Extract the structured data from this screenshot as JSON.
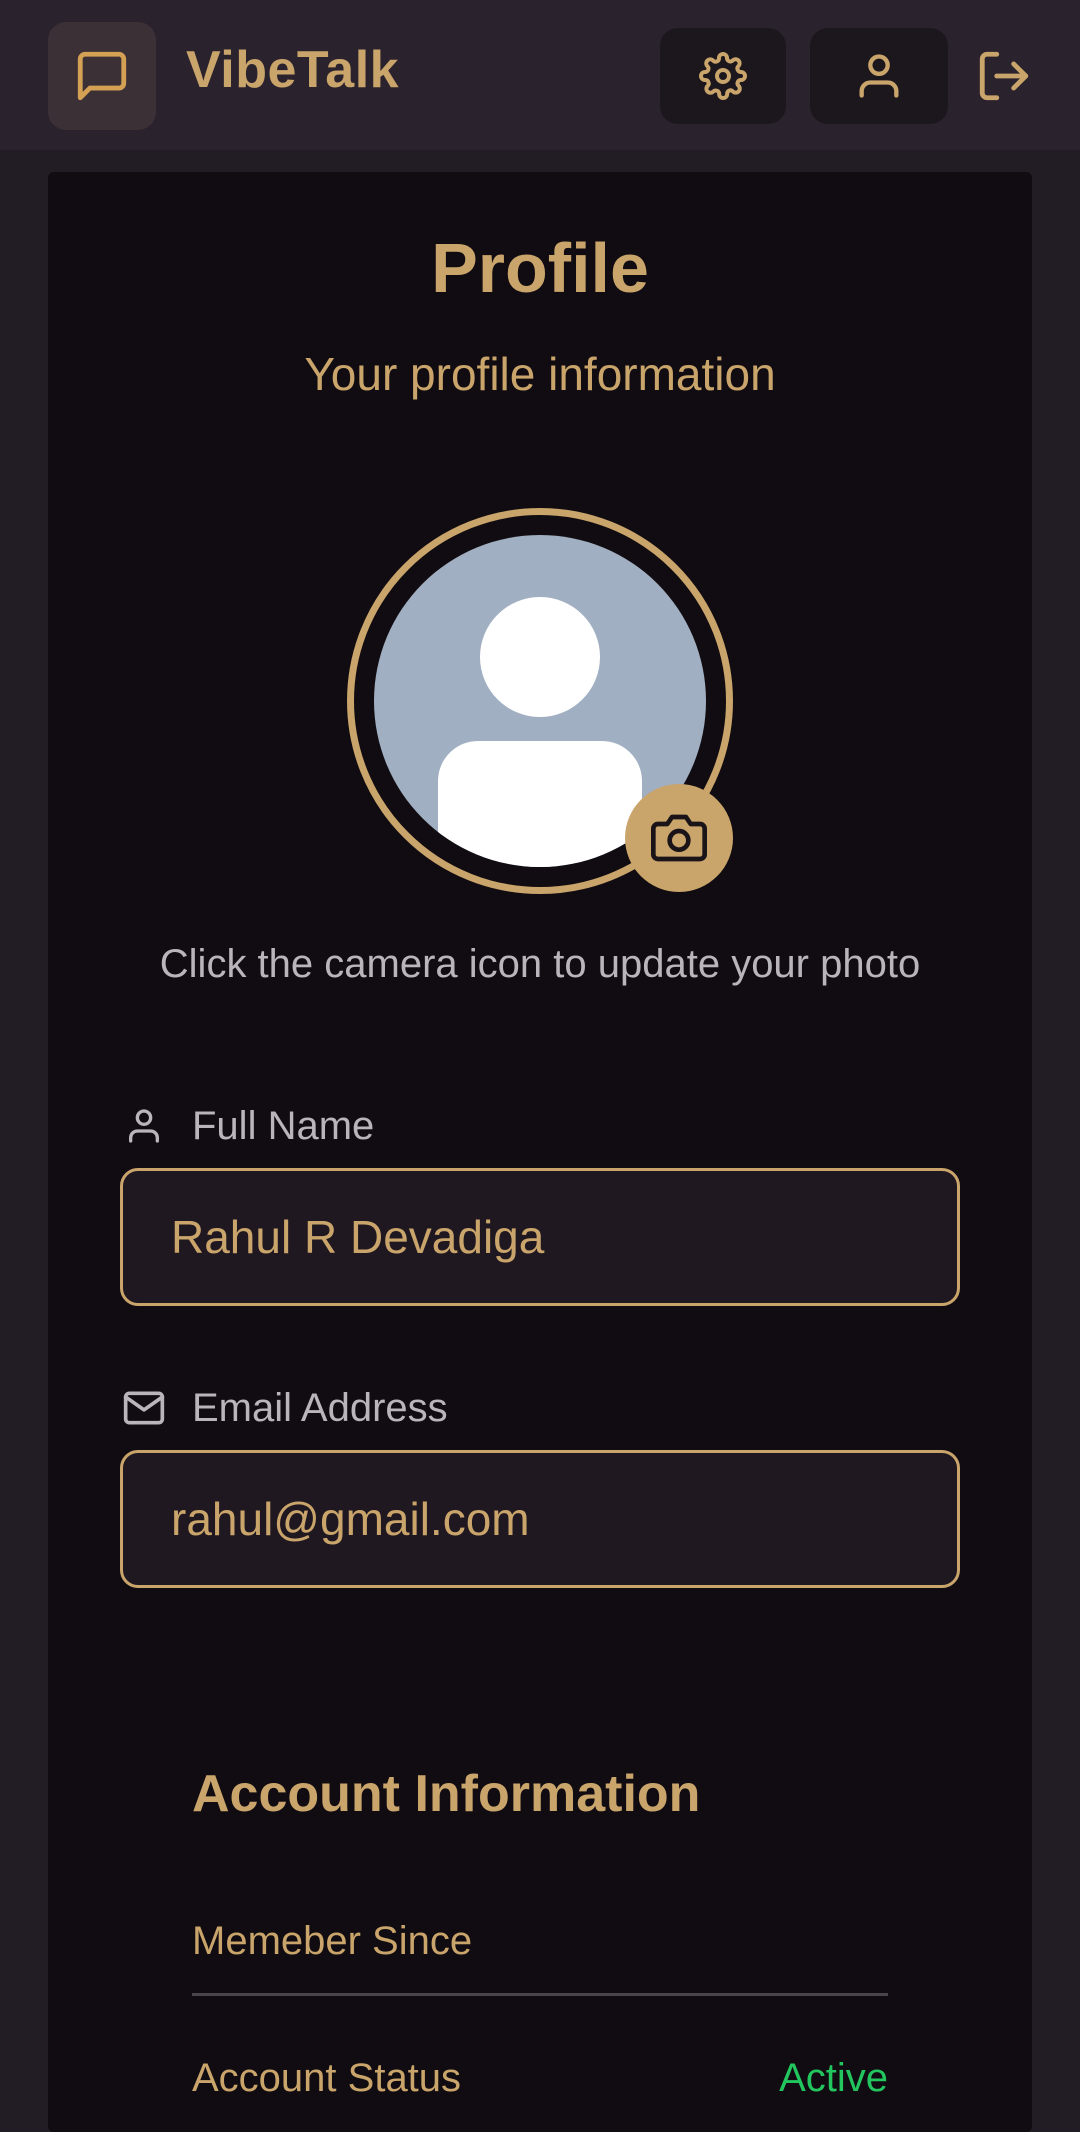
{
  "header": {
    "brand": "VibeTalk",
    "icons": {
      "logo": "message-square-icon",
      "settings": "gear-icon",
      "profile": "user-icon",
      "logout": "logout-icon"
    }
  },
  "profile": {
    "title": "Profile",
    "subtitle": "Your profile information",
    "photo_hint": "Click the camera icon to update your photo",
    "fields": {
      "name_label": "Full Name",
      "name_value": "Rahul R Devadiga",
      "email_label": "Email Address",
      "email_value": "rahul@gmail.com"
    }
  },
  "account": {
    "title": "Account Information",
    "member_since_label": "Memeber Since",
    "member_since_value": "",
    "status_label": "Account Status",
    "status_value": "Active"
  },
  "colors": {
    "accent": "#c9a46b",
    "background": "#221c24",
    "card": "#110c11",
    "status_active": "#22c55e"
  }
}
